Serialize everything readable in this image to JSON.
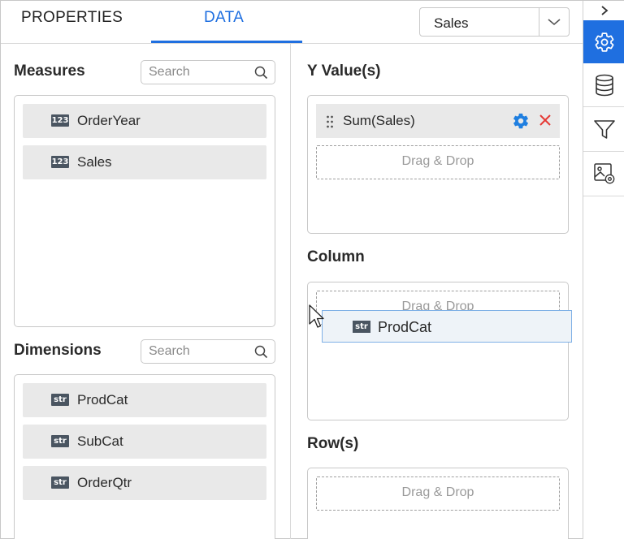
{
  "tabs": {
    "properties": "PROPERTIES",
    "data": "DATA"
  },
  "datasource": {
    "selected": "Sales"
  },
  "measures": {
    "title": "Measures",
    "search_placeholder": "Search",
    "items": [
      {
        "type": "123",
        "label": "OrderYear"
      },
      {
        "type": "123",
        "label": "Sales"
      }
    ]
  },
  "dimensions": {
    "title": "Dimensions",
    "search_placeholder": "Search",
    "items": [
      {
        "type": "str",
        "label": "ProdCat"
      },
      {
        "type": "str",
        "label": "SubCat"
      },
      {
        "type": "str",
        "label": "OrderQtr"
      }
    ]
  },
  "y_values": {
    "title": "Y Value(s)",
    "items": [
      {
        "label": "Sum(Sales)"
      }
    ],
    "drop_label": "Drag & Drop"
  },
  "column": {
    "title": "Column",
    "drop_label": "Drag & Drop"
  },
  "rows": {
    "title": "Row(s)",
    "drop_label": "Drag & Drop"
  },
  "drag_ghost": {
    "type": "str",
    "label": "ProdCat"
  },
  "toolbar": {
    "icons": [
      "chevron-right-icon",
      "gear-icon",
      "database-icon",
      "filter-icon",
      "image-settings-icon"
    ],
    "active": "gear-icon"
  },
  "colors": {
    "accent": "#1f6fe0",
    "remove": "#e53935",
    "badge": "#4a5561"
  }
}
